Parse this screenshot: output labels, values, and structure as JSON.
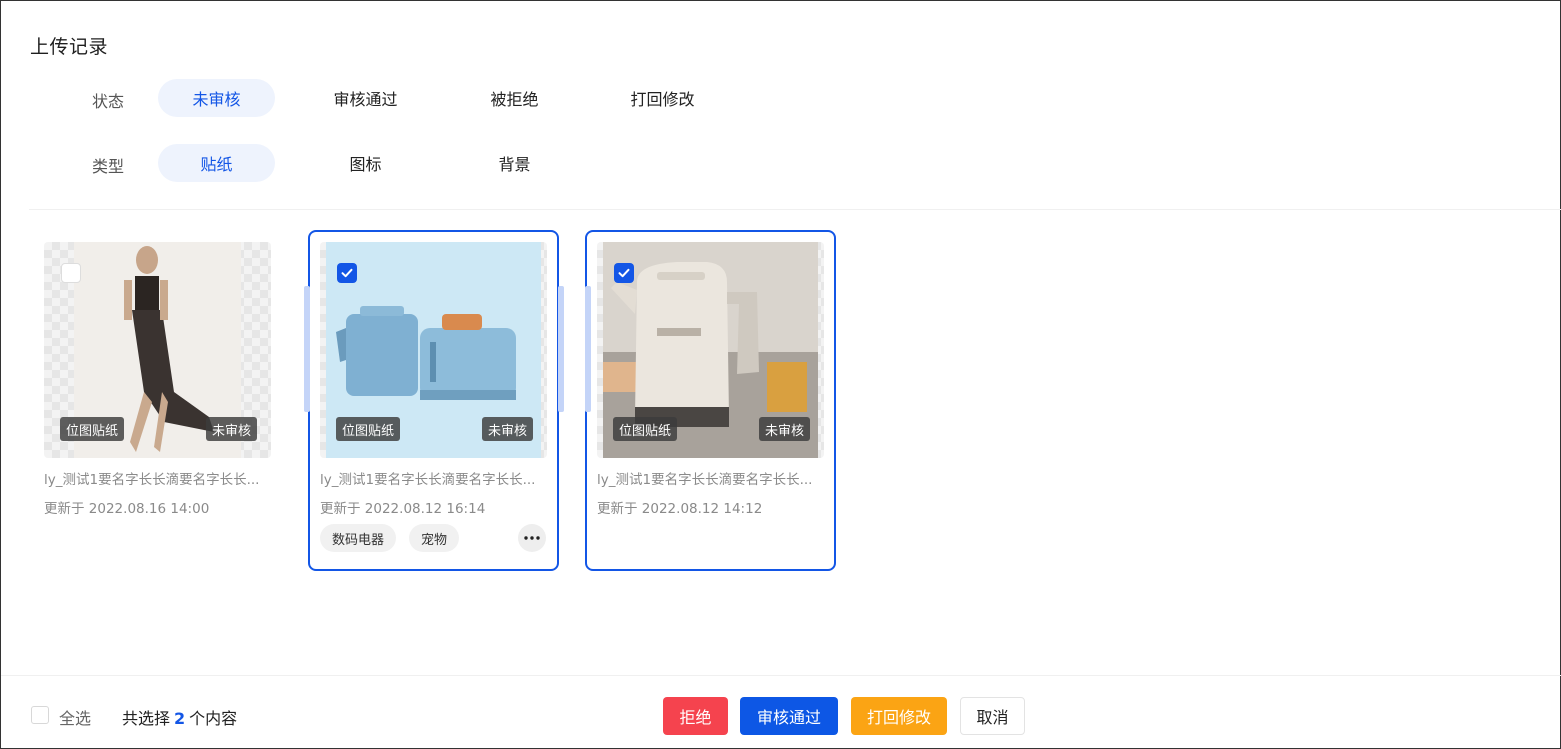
{
  "page": {
    "title": "上传记录"
  },
  "filters": {
    "status": {
      "label": "状态",
      "options": [
        "未审核",
        "审核通过",
        "被拒绝",
        "打回修改"
      ],
      "active": "未审核"
    },
    "type": {
      "label": "类型",
      "options": [
        "贴纸",
        "图标",
        "背景"
      ],
      "active": "贴纸"
    }
  },
  "cards": [
    {
      "name": "ly_测试1要名字长长滴要名字长长...",
      "updated": "更新于 2022.08.16 14:00",
      "type_tag": "位图贴纸",
      "status_tag": "未审核",
      "selected": false,
      "image": "photo of woman in black dress",
      "chips": []
    },
    {
      "name": "ly_测试1要名字长长滴要名字长长...",
      "updated": "更新于 2022.08.12 16:14",
      "type_tag": "位图贴纸",
      "status_tag": "未审核",
      "selected": true,
      "image": "blue kettle and toaster",
      "chips": [
        "数码电器",
        "宠物"
      ]
    },
    {
      "name": "ly_测试1要名字长长滴要名字长长...",
      "updated": "更新于 2022.08.12 14:12",
      "type_tag": "位图贴纸",
      "status_tag": "未审核",
      "selected": true,
      "image": "cream electric kettle",
      "chips": []
    }
  ],
  "footer": {
    "select_all": "全选",
    "selected_prefix": "共选择",
    "selected_count": "2",
    "selected_suffix": "个内容",
    "buttons": {
      "reject": "拒绝",
      "approve": "审核通过",
      "return": "打回修改",
      "cancel": "取消"
    }
  },
  "colors": {
    "accent": "#1356e6",
    "reject": "#f5434e",
    "approve": "#0d57e5",
    "return": "#fba414"
  }
}
